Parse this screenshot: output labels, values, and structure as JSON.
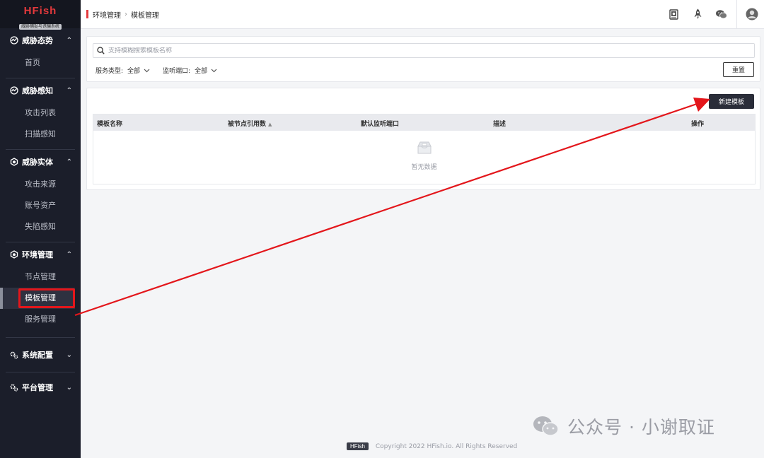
{
  "app": {
    "logo_title": "HFish",
    "logo_subtitle": "威胁捕捉与诱骗系统"
  },
  "sidebar": {
    "groups": [
      {
        "label": "威胁态势",
        "icon": "radar-icon",
        "expanded": true,
        "items": [
          {
            "label": "首页"
          }
        ]
      },
      {
        "label": "威胁感知",
        "icon": "radar-icon",
        "expanded": true,
        "items": [
          {
            "label": "攻击列表"
          },
          {
            "label": "扫描感知"
          }
        ]
      },
      {
        "label": "威胁实体",
        "icon": "cube-icon",
        "expanded": true,
        "items": [
          {
            "label": "攻击来源"
          },
          {
            "label": "账号资产"
          },
          {
            "label": "失陷感知"
          }
        ]
      },
      {
        "label": "环境管理",
        "icon": "cube-icon",
        "expanded": true,
        "items": [
          {
            "label": "节点管理"
          },
          {
            "label": "模板管理",
            "active": true
          },
          {
            "label": "服务管理"
          }
        ]
      },
      {
        "label": "系统配置",
        "icon": "gears-icon",
        "expanded": false,
        "items": []
      },
      {
        "label": "平台管理",
        "icon": "gears-icon",
        "expanded": false,
        "items": []
      }
    ]
  },
  "header": {
    "breadcrumb": [
      "环境管理",
      "模板管理"
    ],
    "icons": [
      "document-icon",
      "rocket-icon",
      "wechat-icon",
      "user-avatar-icon"
    ]
  },
  "filters": {
    "search_placeholder": "支持模糊搜索模板名称",
    "service_type_label": "服务类型:",
    "service_type_value": "全部",
    "listen_port_label": "监听端口:",
    "listen_port_value": "全部",
    "reset_label": "重置"
  },
  "content": {
    "new_button_label": "新建模板",
    "columns": [
      "模板名称",
      "被节点引用数",
      "默认监听端口",
      "描述",
      "操作"
    ],
    "rows": [],
    "empty_text": "暂无数据"
  },
  "footer": {
    "badge": "HFish",
    "copyright": "Copyright 2022 HFish.io. All Rights Reserved"
  },
  "watermark": {
    "text": "公众号 · 小谢取证"
  },
  "annotation": {
    "color": "#e3161b"
  }
}
